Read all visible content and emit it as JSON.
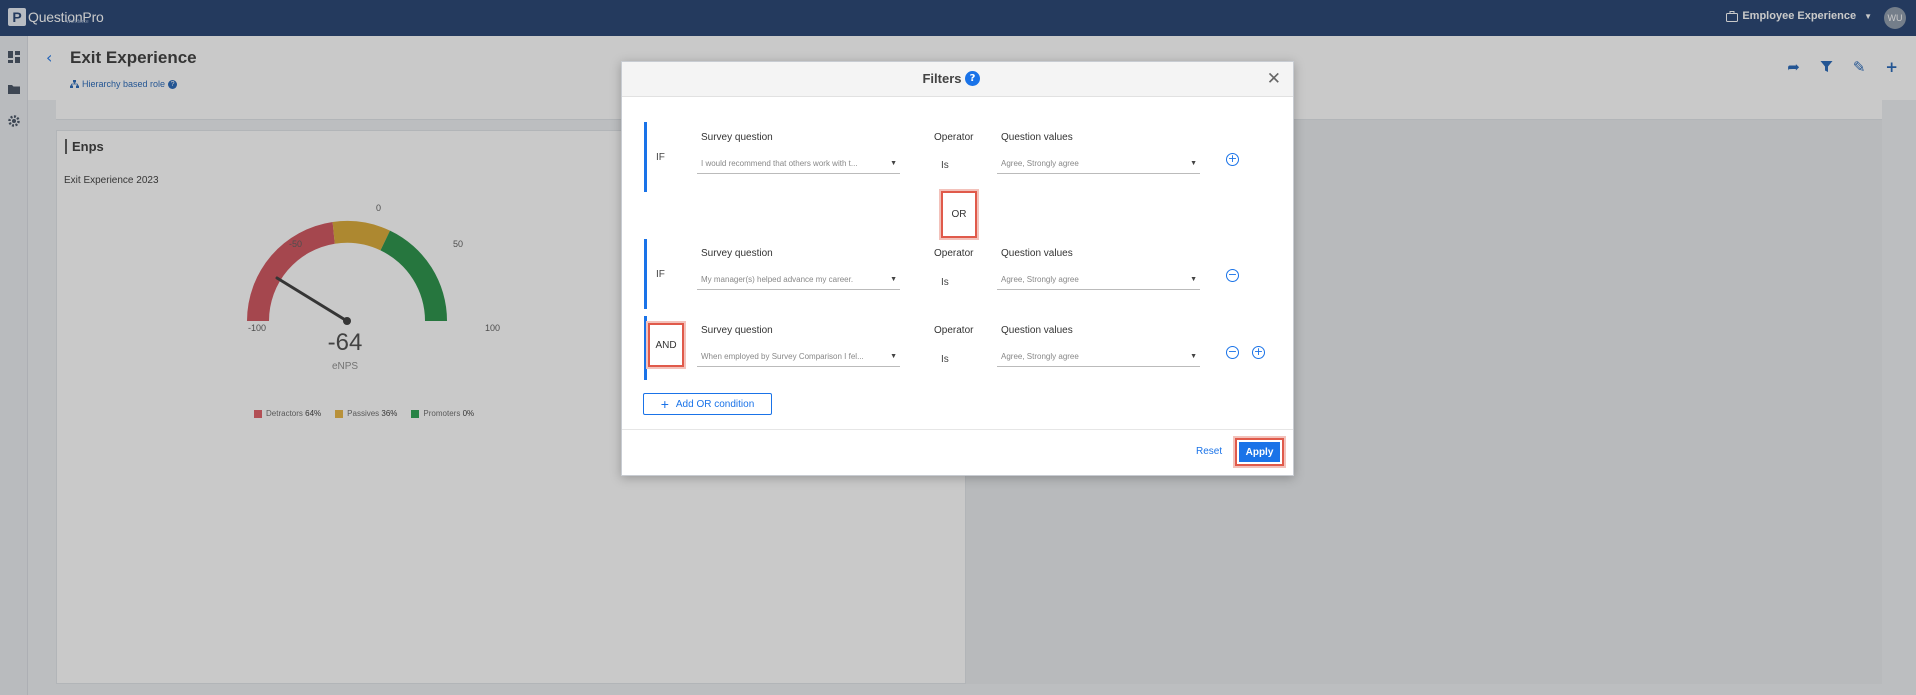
{
  "app": {
    "logo_text": "QuestionPro",
    "logo_sub": "Workforce",
    "product": "Employee Experience",
    "avatar": "WU"
  },
  "header": {
    "title": "Exit Experience",
    "hierarchy_label": "Hierarchy based role"
  },
  "card": {
    "title": "Enps",
    "subtitle": "Exit Experience 2023",
    "ticks": {
      "min": "-100",
      "m50": "-50",
      "zero": "0",
      "p50": "50",
      "max": "100"
    },
    "value": "-64",
    "value_label": "eNPS",
    "legend": [
      {
        "name": "Detractors",
        "pct": "64%",
        "color": "#e0575f"
      },
      {
        "name": "Passives",
        "pct": "36%",
        "color": "#e8b23a"
      },
      {
        "name": "Promoters",
        "pct": "0%",
        "color": "#1f9d49"
      }
    ]
  },
  "colors": {
    "topbar": "#1b3a6b",
    "accent": "#1a73e8",
    "highlight": "#e05a4b"
  },
  "modal": {
    "title": "Filters",
    "conditions": [
      {
        "prefix": "IF",
        "survey_label": "Survey question",
        "survey_value": "I would recommend that others work with t...",
        "operator_label": "Operator",
        "operator_value": "Is",
        "values_label": "Question values",
        "values_value": "Agree, Strongly agree"
      },
      {
        "prefix": "IF",
        "survey_label": "Survey question",
        "survey_value": "My manager(s) helped advance my career.",
        "operator_label": "Operator",
        "operator_value": "Is",
        "values_label": "Question values",
        "values_value": "Agree, Strongly agree"
      },
      {
        "prefix": "AND",
        "survey_label": "Survey question",
        "survey_value": "When employed by Survey Comparison I fel...",
        "operator_label": "Operator",
        "operator_value": "Is",
        "values_label": "Question values",
        "values_value": "Agree, Strongly agree"
      }
    ],
    "or_label": "OR",
    "add_or_label": "Add OR condition",
    "reset_label": "Reset",
    "apply_label": "Apply"
  }
}
